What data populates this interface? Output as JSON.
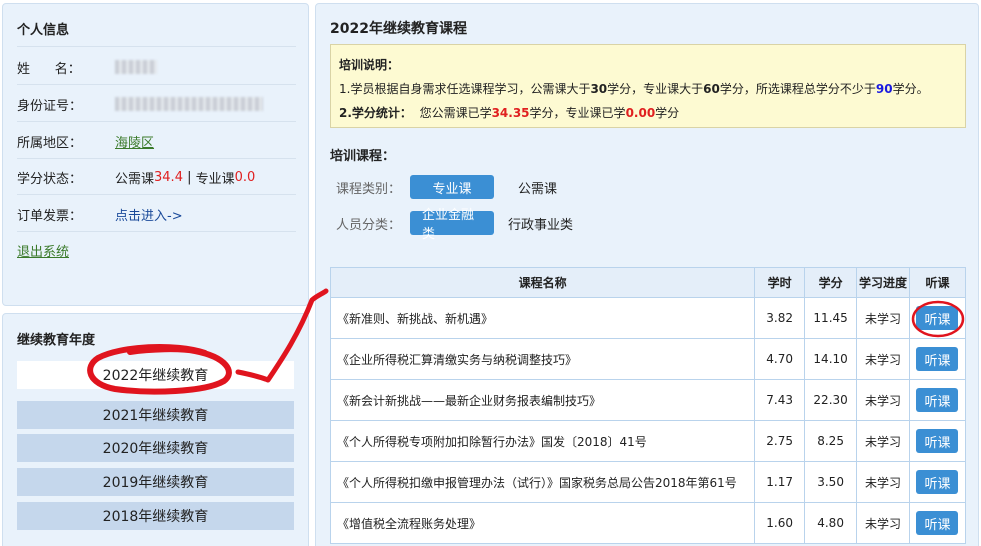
{
  "personal_info": {
    "title": "个人信息",
    "rows": [
      {
        "label": "姓      名：",
        "value": ""
      },
      {
        "label": "身份证号：",
        "value": ""
      },
      {
        "label": "所属地区：",
        "value": "海陵区"
      },
      {
        "label": "学分状态："
      },
      {
        "label": "订单发票：",
        "value": "点击进入->"
      }
    ],
    "credit_status": {
      "public_label": "公需课",
      "public_value": "34.4",
      "divider": " | ",
      "professional_label": "专业课",
      "professional_value": "0.0"
    },
    "logout": "退出系统"
  },
  "years": {
    "title": "继续教育年度",
    "items": [
      "2022年继续教育",
      "2021年继续教育",
      "2020年继续教育",
      "2019年继续教育",
      "2018年继续教育"
    ],
    "selected_index": 0
  },
  "main": {
    "title": "2022年继续教育课程",
    "notice": {
      "heading": "培训说明：",
      "line1_a": "1.学员根据自身需求任选课程学习，公需课大于",
      "line1_b": "30",
      "line1_c": "学分，专业课大于",
      "line1_d": "60",
      "line1_e": "学分，所选课程总学分不少于",
      "line1_f": "90",
      "line1_g": "学分。",
      "line2_label": "2.学分统计：",
      "line2_a": "您公需课已学",
      "line2_b": "34.35",
      "line2_c": "学分，专业课已学",
      "line2_d": "0.00",
      "line2_e": "学分"
    },
    "section_label": "培训课程：",
    "filters": {
      "category_label": "课程类别：",
      "category_options": [
        "专业课",
        "公需课"
      ],
      "category_selected": 0,
      "staff_label": "人员分类：",
      "staff_options": [
        "企业金融类",
        "行政事业类"
      ],
      "staff_selected": 0
    },
    "table": {
      "headers": [
        "课程名称",
        "学时",
        "学分",
        "学习进度",
        "听课"
      ],
      "rows": [
        {
          "name": "《新准则、新挑战、新机遇》",
          "hours": "3.82",
          "credits": "11.45",
          "progress": "未学习",
          "action": "听课"
        },
        {
          "name": "《企业所得税汇算清缴实务与纳税调整技巧》",
          "hours": "4.70",
          "credits": "14.10",
          "progress": "未学习",
          "action": "听课"
        },
        {
          "name": "《新会计新挑战——最新企业财务报表编制技巧》",
          "hours": "7.43",
          "credits": "22.30",
          "progress": "未学习",
          "action": "听课"
        },
        {
          "name": "《个人所得税专项附加扣除暂行办法》国发〔2018〕41号",
          "hours": "2.75",
          "credits": "8.25",
          "progress": "未学习",
          "action": "听课"
        },
        {
          "name": "《个人所得税扣缴申报管理办法（试行）》国家税务总局公告2018年第61号",
          "hours": "1.17",
          "credits": "3.50",
          "progress": "未学习",
          "action": "听课"
        },
        {
          "name": "《增值税全流程账务处理》",
          "hours": "1.60",
          "credits": "4.80",
          "progress": "未学习",
          "action": "听课"
        }
      ]
    }
  },
  "colors": {
    "panel_bg": "#e9f2fb",
    "accent_blue": "#3b8fd4",
    "annotation_red": "#e0141e",
    "highlight_red": "#e02020"
  }
}
